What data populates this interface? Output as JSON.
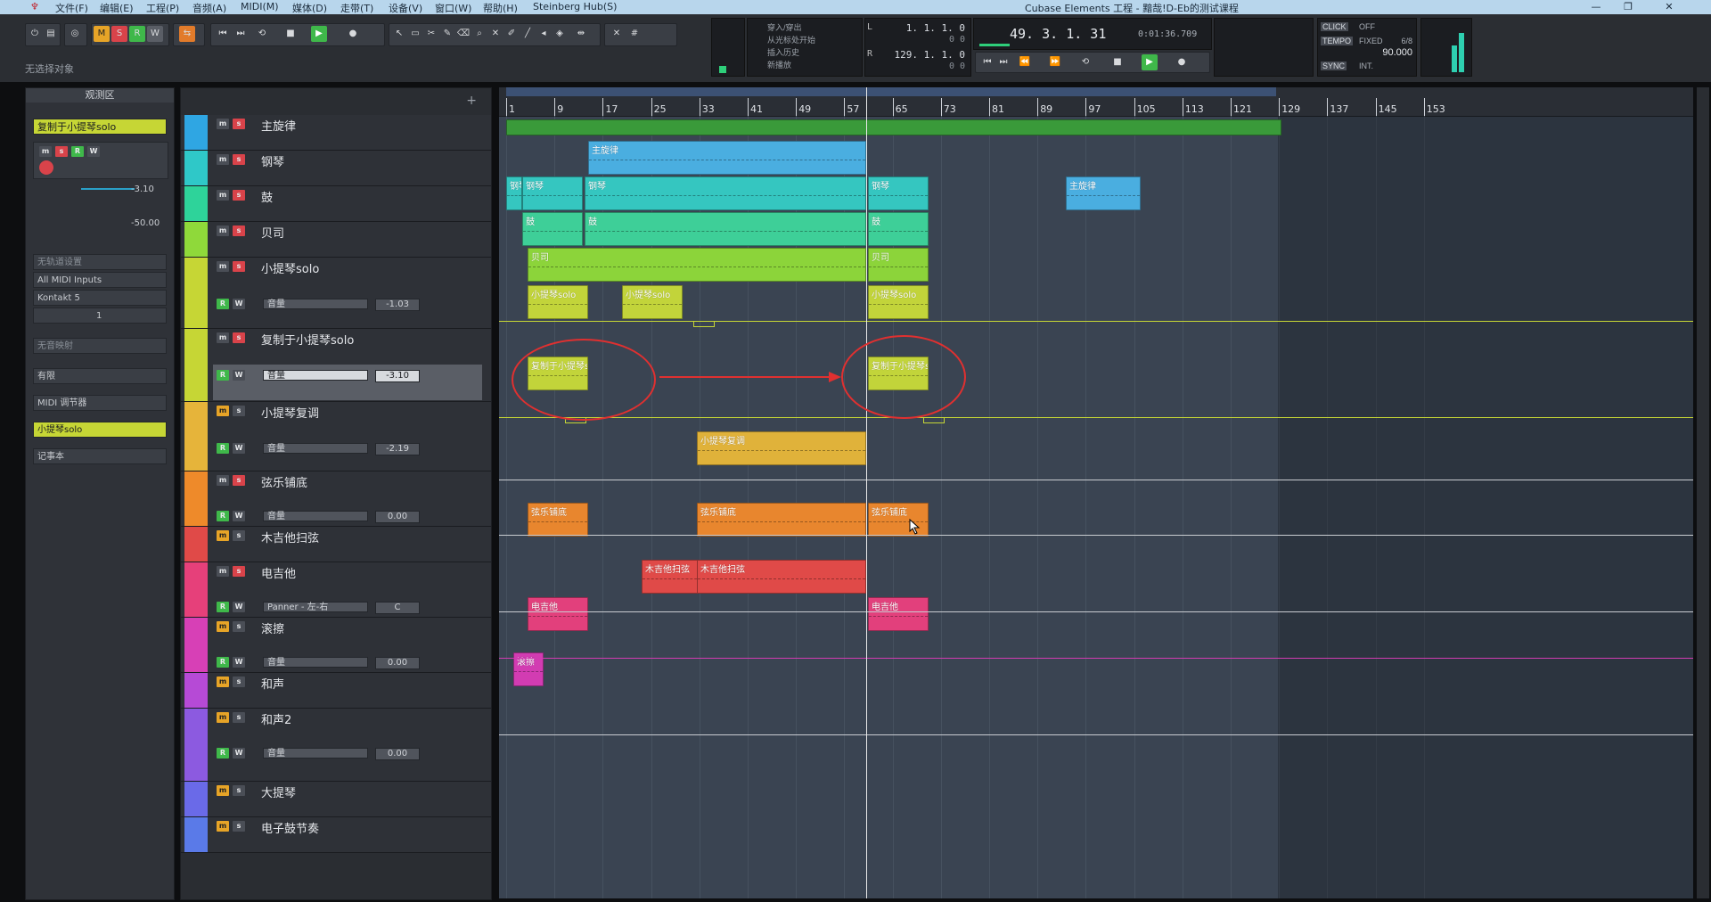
{
  "menubar": {
    "items": [
      "文件(F)",
      "编辑(E)",
      "工程(P)",
      "音频(A)",
      "MIDI(M)",
      "媒体(D)",
      "走带(T)",
      "设备(V)",
      "窗口(W)",
      "帮助(H)",
      "Steinberg Hub(S)"
    ],
    "window_title": "Cubase Elements 工程 - 黯哉!D-Eb的测试课程"
  },
  "toolbar": {
    "msrw": [
      "M",
      "S",
      "R",
      "W"
    ],
    "no_selection": "无选择对象",
    "marker_lines": [
      "穿入/穿出",
      "从光标处开始",
      "插入历史",
      "新播放"
    ],
    "left_locator": "1. 1. 1.   0",
    "left_locator_sub": "0   0",
    "right_locator": "129. 1. 1.   0",
    "right_locator_sub": "0   0",
    "position_bars": "49. 3. 1. 31",
    "position_time": "0:01:36.709",
    "click": "CLICK",
    "click_state": "OFF",
    "tempo": "TEMPO",
    "tempo_mode": "FIXED",
    "time_sig": "6/8",
    "bpm": "90.000",
    "sync": "SYNC",
    "sync_mode": "INT."
  },
  "inspector": {
    "title": "观测区",
    "track_name": "复制于小提琴solo",
    "volume": "-3.10",
    "pan": "-50.00",
    "input": "无轨道设置",
    "midi_input": "All MIDI Inputs",
    "output": "Kontakt 5",
    "channel": "1",
    "no_mapping": "无音映射",
    "sections": [
      "有限",
      "MIDI 调节器",
      "小提琴solo",
      "记事本"
    ]
  },
  "tracks": [
    {
      "id": 1,
      "name": "主旋律",
      "color": "#2fa6e3"
    },
    {
      "id": 2,
      "name": "钢琴",
      "color": "#2fc8c8"
    },
    {
      "id": 3,
      "name": "鼓",
      "color": "#2ed39a"
    },
    {
      "id": 4,
      "name": "贝司",
      "color": "#8fd93a"
    },
    {
      "id": 5,
      "name": "小提琴solo",
      "color": "#c6d635",
      "lane": "音量",
      "lane_value": "-1.03"
    },
    {
      "id": 6,
      "name": "复制于小提琴solo",
      "color": "#c6d635",
      "lane": "音量",
      "lane_value": "-3.10"
    },
    {
      "id": 7,
      "name": "小提琴复调",
      "color": "#e6b43a",
      "lane": "音量",
      "lane_value": "-2.19"
    },
    {
      "id": 8,
      "name": "弦乐铺底",
      "color": "#ee8a2a",
      "lane": "音量",
      "lane_value": "0.00"
    },
    {
      "id": 9,
      "name": "木吉他扫弦",
      "color": "#e04a48"
    },
    {
      "id": 10,
      "name": "电吉他",
      "color": "#e6407a",
      "lane": "Panner - 左-右",
      "lane_value": "C"
    },
    {
      "id": 11,
      "name": "滚擦",
      "color": "#d740b6",
      "lane": "音量",
      "lane_value": "0.00"
    },
    {
      "id": 12,
      "name": "和声",
      "color": "#b64ad6"
    },
    {
      "id": 13,
      "name": "和声2",
      "color": "#8c5ae0",
      "lane": "音量",
      "lane_value": "0.00"
    },
    {
      "id": 14,
      "name": "大提琴",
      "color": "#6a6ae8"
    },
    {
      "id": 15,
      "name": "电子鼓节奏",
      "color": "#5a7ae8"
    }
  ],
  "ruler": [
    "1",
    "9",
    "17",
    "25",
    "33",
    "41",
    "49",
    "57",
    "65",
    "73",
    "81",
    "89",
    "97",
    "105",
    "113",
    "121",
    "129",
    "137",
    "145",
    "153"
  ],
  "parts": [
    {
      "label": "主旋律",
      "color": "#4aaee0"
    },
    {
      "label": "钢琴",
      "color": "#35c6c0"
    },
    {
      "label": "鼓",
      "color": "#3ecf98"
    },
    {
      "label": "贝司",
      "color": "#8cd43a"
    },
    {
      "label": "小提琴solo",
      "color": "#c2d43a"
    },
    {
      "label": "复制于小提琴solo",
      "color": "#c2d43a"
    },
    {
      "label": "小提琴复调",
      "color": "#e0b23a"
    },
    {
      "label": "弦乐铺底",
      "color": "#e8862e"
    },
    {
      "label": "木吉他扫弦",
      "color": "#e04a48"
    },
    {
      "label": "电吉他",
      "color": "#e2407c"
    },
    {
      "label": "滚擦",
      "color": "#d23cb2"
    }
  ]
}
